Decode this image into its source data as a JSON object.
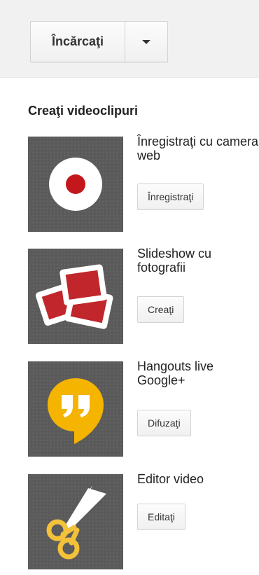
{
  "header": {
    "upload_label": "Încărcaţi"
  },
  "section": {
    "title": "Creaţi videoclipuri"
  },
  "items": [
    {
      "title": "Înregistraţi cu camera web",
      "button_label": "Înregistraţi",
      "icon": "webcam-record-icon"
    },
    {
      "title": "Slideshow cu fotografii",
      "button_label": "Creaţi",
      "icon": "photo-slideshow-icon"
    },
    {
      "title": "Hangouts live Google+",
      "button_label": "Difuzaţi",
      "icon": "hangouts-icon"
    },
    {
      "title": "Editor video",
      "button_label": "Editaţi",
      "icon": "scissors-icon"
    }
  ],
  "colors": {
    "header_bg": "#f1f1f1",
    "thumb_bg": "#5a5a5a",
    "record_red": "#c4171c",
    "slide_red": "#c0262b",
    "hangouts_yellow": "#f4b400",
    "scissors_yellow": "#f3c13a"
  }
}
